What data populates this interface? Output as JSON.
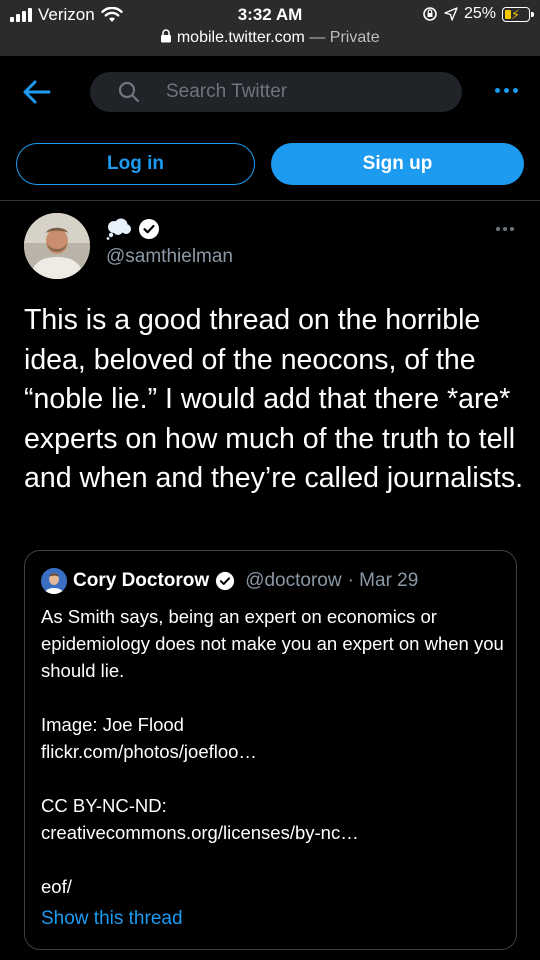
{
  "status_bar": {
    "carrier": "Verizon",
    "time": "3:32 AM",
    "battery": "25%",
    "url_host": "mobile.twitter.com",
    "url_suffix": "— Private"
  },
  "header": {
    "search_placeholder": "Search Twitter",
    "login_label": "Log in",
    "signup_label": "Sign up",
    "accent_color": "#1d9bf0"
  },
  "tweet": {
    "handle": "@samthielman",
    "text": "This is a good thread on the horrible idea, beloved of the neocons, of the “noble lie.” I would add that there *are* experts on how much of the truth to tell and when and they’re called journalists.",
    "quote": {
      "author_name": "Cory Doctorow",
      "author_handle": "@doctorow",
      "date": "· Mar 29",
      "paragraphs": [
        "As Smith says, being an expert on economics or epidemiology does not make you an expert on when you should lie.",
        "Image: Joe Flood",
        "flickr.com/photos/joefloo…",
        "CC BY-NC-ND:",
        "creativecommons.org/licenses/by-nc…",
        "eof/"
      ],
      "show_thread_label": "Show this thread"
    }
  }
}
